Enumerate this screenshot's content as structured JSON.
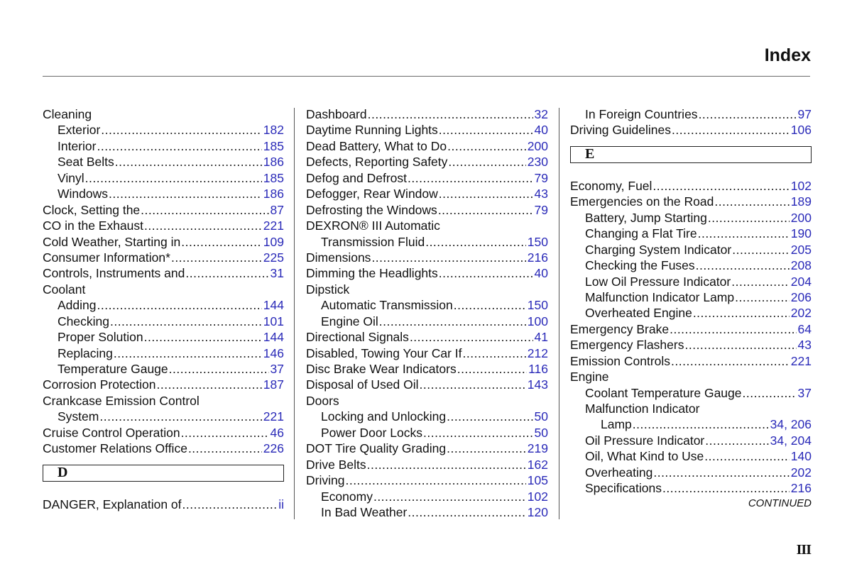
{
  "header": {
    "title": "Index"
  },
  "footer": {
    "page_number": "III",
    "continued": "CONTINUED"
  },
  "colors": {
    "page_ref": "#2a2ab8",
    "text": "#111111"
  },
  "columns": [
    {
      "blocks": [
        {
          "type": "entries",
          "entries": [
            {
              "label": "Cleaning",
              "level": 0,
              "page": ""
            },
            {
              "label": "Exterior",
              "level": 1,
              "page": "182"
            },
            {
              "label": "Interior",
              "level": 1,
              "page": "185"
            },
            {
              "label": "Seat Belts",
              "level": 1,
              "page": "186"
            },
            {
              "label": "Vinyl",
              "level": 1,
              "page": "185"
            },
            {
              "label": "Windows",
              "level": 1,
              "page": "186"
            },
            {
              "label": "Clock, Setting the",
              "level": 0,
              "page": "87"
            },
            {
              "label": "CO in the Exhaust",
              "level": 0,
              "page": "221"
            },
            {
              "label": "Cold Weather, Starting in",
              "level": 0,
              "page": "109"
            },
            {
              "label": "Consumer Information*",
              "level": 0,
              "page": "225"
            },
            {
              "label": "Controls, Instruments and",
              "level": 0,
              "page": "31"
            },
            {
              "label": "Coolant",
              "level": 0,
              "page": ""
            },
            {
              "label": "Adding",
              "level": 1,
              "page": "144"
            },
            {
              "label": "Checking",
              "level": 1,
              "page": "101"
            },
            {
              "label": "Proper Solution",
              "level": 1,
              "page": "144"
            },
            {
              "label": "Replacing",
              "level": 1,
              "page": "146"
            },
            {
              "label": "Temperature Gauge",
              "level": 1,
              "page": "37"
            },
            {
              "label": "Corrosion Protection",
              "level": 0,
              "page": "187"
            },
            {
              "label": "Crankcase Emission Control",
              "level": 0,
              "page": ""
            },
            {
              "label": "System",
              "level": 1,
              "page": "221"
            },
            {
              "label": "Cruise Control Operation",
              "level": 0,
              "page": "46"
            },
            {
              "label": "Customer Relations Office",
              "level": 0,
              "page": "226"
            }
          ]
        },
        {
          "type": "section",
          "letter": "D"
        },
        {
          "type": "entries",
          "entries": [
            {
              "label": "DANGER, Explanation of",
              "level": 0,
              "page": "ii"
            }
          ]
        }
      ]
    },
    {
      "blocks": [
        {
          "type": "entries",
          "entries": [
            {
              "label": "Dashboard",
              "level": 0,
              "page": "32"
            },
            {
              "label": "Daytime Running Lights",
              "level": 0,
              "page": "40"
            },
            {
              "label": "Dead Battery, What to Do",
              "level": 0,
              "page": "200"
            },
            {
              "label": "Defects, Reporting Safety",
              "level": 0,
              "page": "230"
            },
            {
              "label": "Defog and Defrost",
              "level": 0,
              "page": "79"
            },
            {
              "label": "Defogger, Rear Window",
              "level": 0,
              "page": "43"
            },
            {
              "label": "Defrosting the Windows",
              "level": 0,
              "page": "79"
            },
            {
              "label": "DEXRON® III Automatic",
              "level": 0,
              "page": ""
            },
            {
              "label": "Transmission Fluid",
              "level": 1,
              "page": "150"
            },
            {
              "label": "Dimensions",
              "level": 0,
              "page": "216"
            },
            {
              "label": "Dimming the Headlights",
              "level": 0,
              "page": "40"
            },
            {
              "label": "Dipstick",
              "level": 0,
              "page": ""
            },
            {
              "label": "Automatic Transmission",
              "level": 1,
              "page": "150"
            },
            {
              "label": "Engine Oil",
              "level": 1,
              "page": "100"
            },
            {
              "label": "Directional Signals",
              "level": 0,
              "page": "41"
            },
            {
              "label": "Disabled, Towing Your Car If",
              "level": 0,
              "page": "212"
            },
            {
              "label": "Disc Brake Wear Indicators",
              "level": 0,
              "page": "116"
            },
            {
              "label": "Disposal of Used Oil",
              "level": 0,
              "page": "143"
            },
            {
              "label": "Doors",
              "level": 0,
              "page": ""
            },
            {
              "label": "Locking and Unlocking",
              "level": 1,
              "page": "50"
            },
            {
              "label": "Power Door Locks",
              "level": 1,
              "page": "50"
            },
            {
              "label": "DOT Tire Quality Grading",
              "level": 0,
              "page": "219"
            },
            {
              "label": "Drive Belts",
              "level": 0,
              "page": "162"
            },
            {
              "label": "Driving",
              "level": 0,
              "page": "105"
            },
            {
              "label": "Economy",
              "level": 1,
              "page": "102"
            },
            {
              "label": "In Bad Weather",
              "level": 1,
              "page": "120"
            }
          ]
        }
      ]
    },
    {
      "blocks": [
        {
          "type": "entries",
          "entries": [
            {
              "label": "In Foreign Countries",
              "level": 1,
              "page": "97"
            },
            {
              "label": "Driving Guidelines",
              "level": 0,
              "page": "106"
            }
          ]
        },
        {
          "type": "section",
          "letter": "E"
        },
        {
          "type": "entries",
          "entries": [
            {
              "label": "Economy, Fuel",
              "level": 0,
              "page": "102"
            },
            {
              "label": "Emergencies on the Road",
              "level": 0,
              "page": "189"
            },
            {
              "label": "Battery, Jump Starting",
              "level": 1,
              "page": "200"
            },
            {
              "label": "Changing a Flat Tire",
              "level": 1,
              "page": "190"
            },
            {
              "label": "Charging System Indicator",
              "level": 1,
              "page": "205"
            },
            {
              "label": "Checking the Fuses",
              "level": 1,
              "page": "208"
            },
            {
              "label": "Low Oil Pressure Indicator",
              "level": 1,
              "page": "204"
            },
            {
              "label": "Malfunction Indicator Lamp",
              "level": 1,
              "page": "206"
            },
            {
              "label": "Overheated Engine",
              "level": 1,
              "page": "202"
            },
            {
              "label": "Emergency Brake",
              "level": 0,
              "page": "64"
            },
            {
              "label": "Emergency Flashers",
              "level": 0,
              "page": "43"
            },
            {
              "label": "Emission Controls",
              "level": 0,
              "page": "221"
            },
            {
              "label": "Engine",
              "level": 0,
              "page": ""
            },
            {
              "label": "Coolant Temperature Gauge",
              "level": 1,
              "page": "37"
            },
            {
              "label": "Malfunction Indicator",
              "level": 1,
              "page": ""
            },
            {
              "label": "Lamp",
              "level": 2,
              "page": "34, 206"
            },
            {
              "label": "Oil Pressure Indicator",
              "level": 1,
              "page": "34, 204"
            },
            {
              "label": "Oil, What Kind to Use",
              "level": 1,
              "page": "140"
            },
            {
              "label": "Overheating",
              "level": 1,
              "page": "202"
            },
            {
              "label": "Specifications",
              "level": 1,
              "page": "216"
            }
          ]
        },
        {
          "type": "continued"
        }
      ]
    }
  ]
}
